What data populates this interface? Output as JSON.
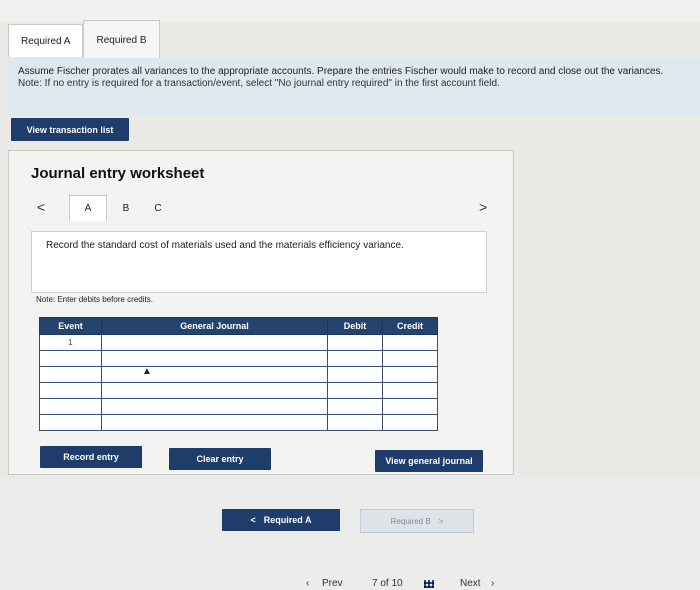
{
  "tabs": [
    {
      "label": "Required A",
      "active": false
    },
    {
      "label": "Required B",
      "active": true
    }
  ],
  "instructions": {
    "text": "Assume Fischer prorates all variances to the appropriate accounts. Prepare the entries Fischer would make to record and close out the variances.",
    "note": "Note: If no entry is required for a transaction/event, select \"No journal entry required\" in the first account field."
  },
  "view_transaction_list": "View transaction list",
  "worksheet": {
    "title": "Journal entry worksheet",
    "tabs": [
      "A",
      "B",
      "C"
    ],
    "active_tab": "A",
    "prev_arrow": "<",
    "next_arrow": ">",
    "description": "Record the standard cost of materials used and the materials efficiency variance.",
    "note": "Note: Enter debits before credits.",
    "columns": [
      "Event",
      "General Journal",
      "Debit",
      "Credit"
    ],
    "rows": [
      {
        "event": "1",
        "account": "",
        "debit": "",
        "credit": ""
      },
      {
        "event": "",
        "account": "",
        "debit": "",
        "credit": ""
      },
      {
        "event": "",
        "account": "",
        "debit": "",
        "credit": ""
      },
      {
        "event": "",
        "account": "",
        "debit": "",
        "credit": ""
      },
      {
        "event": "",
        "account": "",
        "debit": "",
        "credit": ""
      },
      {
        "event": "",
        "account": "",
        "debit": "",
        "credit": ""
      }
    ],
    "record_entry": "Record entry",
    "clear_entry": "Clear entry",
    "view_general_journal": "View general journal"
  },
  "nav": {
    "required_a": "Required A",
    "required_b": "Required B",
    "prev_arrow": "<",
    "next_arrow": ">"
  },
  "pager": {
    "prev": "Prev",
    "position": "7 of 10",
    "next": "Next"
  },
  "icons": {
    "prev_chevron": "chevron-left-icon",
    "next_chevron": "chevron-right-icon",
    "grid": "grid-icon"
  }
}
